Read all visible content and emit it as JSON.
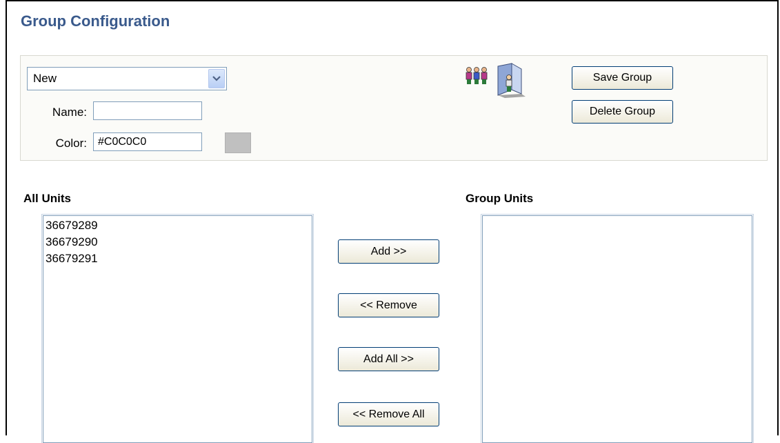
{
  "page": {
    "title": "Group Configuration"
  },
  "config": {
    "group_select": {
      "selected": "New"
    },
    "name": {
      "label": "Name:",
      "value": ""
    },
    "color": {
      "label": "Color:",
      "value": "#C0C0C0",
      "swatch_color": "#C0C0C0"
    },
    "icon": "group-users-icon",
    "save_label": "Save Group",
    "delete_label": "Delete Group"
  },
  "all_units": {
    "label": "All Units",
    "items": [
      "36679289",
      "36679290",
      "36679291"
    ]
  },
  "group_units": {
    "label": "Group Units",
    "items": []
  },
  "actions": {
    "add": "Add >>",
    "remove": "<< Remove",
    "add_all": "Add All >>",
    "remove_all": "<< Remove All"
  },
  "colors": {
    "title": "#3A5A8C",
    "panel_bg": "#FBFBF8",
    "button_border": "#003C74"
  }
}
